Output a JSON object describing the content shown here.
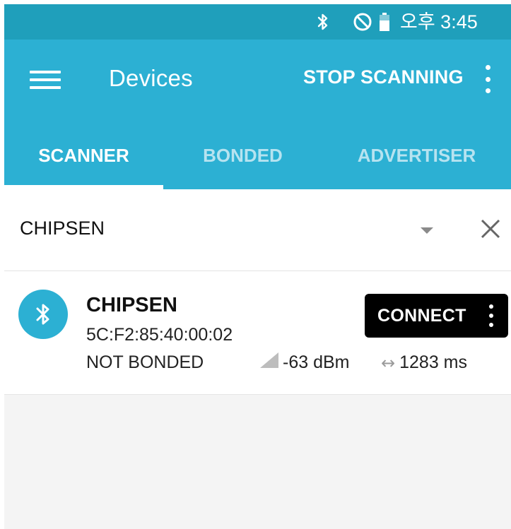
{
  "status_bar": {
    "time": "오후 3:45",
    "icons": [
      "bluetooth-icon",
      "do-not-disturb-icon",
      "battery-icon"
    ]
  },
  "app_bar": {
    "title": "Devices",
    "stop_scanning_label": "STOP SCANNING",
    "icons": [
      "menu-icon",
      "overflow-menu-icon"
    ]
  },
  "tabs": [
    {
      "label": "SCANNER",
      "active": true
    },
    {
      "label": "BONDED",
      "active": false
    },
    {
      "label": "ADVERTISER",
      "active": false
    }
  ],
  "filter": {
    "value": "CHIPSEN",
    "icons": [
      "dropdown-icon",
      "clear-icon"
    ]
  },
  "devices": [
    {
      "name": "CHIPSEN",
      "address": "5C:F2:85:40:00:02",
      "bond_state": "NOT BONDED",
      "rssi": "-63 dBm",
      "interval": "1283 ms",
      "connect_label": "CONNECT",
      "icon": "bluetooth-icon"
    }
  ],
  "colors": {
    "status_bar": "#1f9fbb",
    "primary": "#2cb0d3",
    "tab_inactive": "#b6e3f0",
    "connect_button": "#000000",
    "background": "#f4f4f4"
  }
}
